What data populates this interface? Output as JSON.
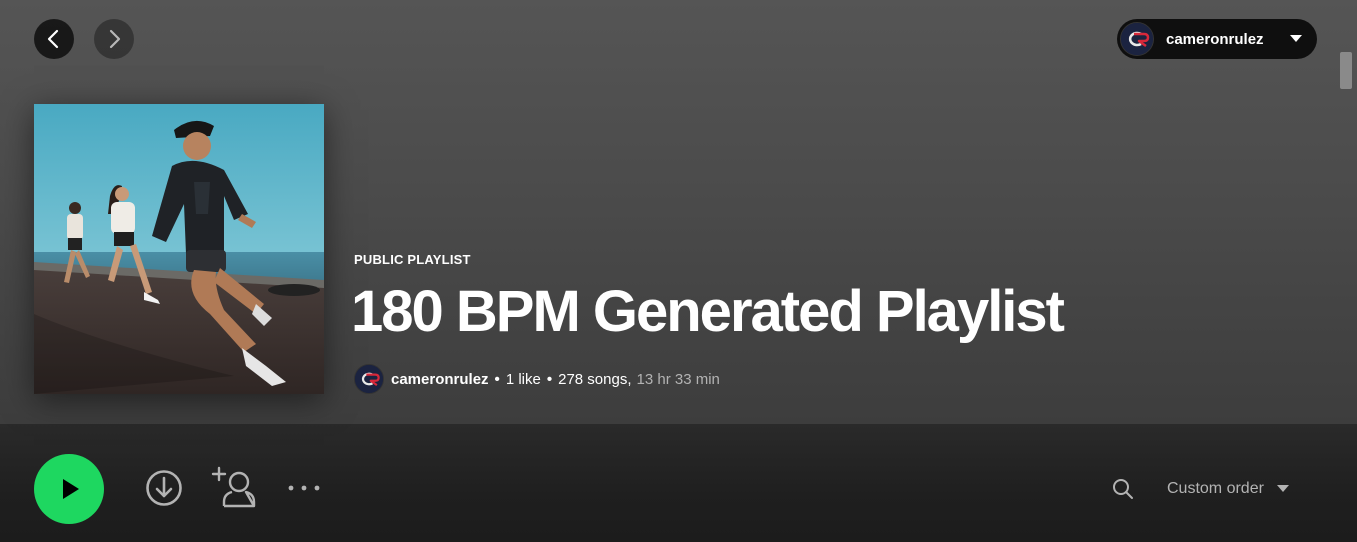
{
  "nav": {
    "back_icon": "chevron-left-icon",
    "forward_icon": "chevron-right-icon"
  },
  "user": {
    "name": "cameronrulez",
    "menu_icon": "caret-down-icon"
  },
  "playlist": {
    "kind": "PUBLIC PLAYLIST",
    "title": "180 BPM Generated Playlist",
    "owner": "cameronrulez",
    "likes": "1 like",
    "songs": "278 songs,",
    "duration": "13 hr 33 min"
  },
  "actions": {
    "play_icon": "play-icon",
    "download_icon": "download-icon",
    "invite_icon": "add-user-icon",
    "more_icon": "more-icon",
    "search_icon": "search-icon",
    "sort_label": "Custom order"
  },
  "colors": {
    "accent": "#1ed760",
    "text_muted": "#b3b3b3"
  }
}
